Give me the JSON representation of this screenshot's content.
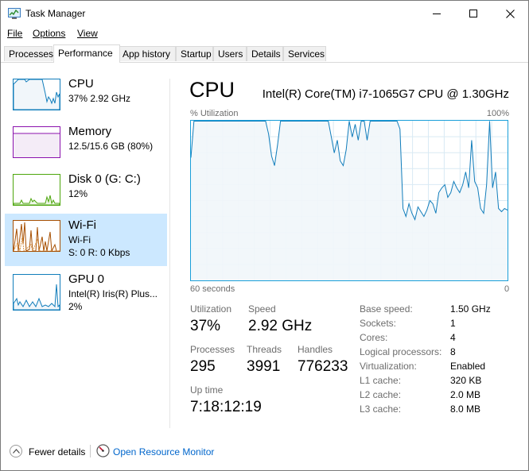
{
  "window": {
    "title": "Task Manager",
    "icons": {
      "app": "task-manager-icon",
      "minimize": "minimize-icon",
      "maximize": "maximize-icon",
      "close": "close-icon"
    }
  },
  "menu": [
    {
      "label": "File"
    },
    {
      "label": "Options"
    },
    {
      "label": "View"
    }
  ],
  "tabs": [
    {
      "label": "Processes"
    },
    {
      "label": "Performance",
      "active": true
    },
    {
      "label": "App history"
    },
    {
      "label": "Startup"
    },
    {
      "label": "Users"
    },
    {
      "label": "Details"
    },
    {
      "label": "Services"
    }
  ],
  "sidebar": {
    "items": [
      {
        "name": "CPU",
        "line1": "37%  2.92 GHz",
        "line2": "",
        "color": "#117dbb"
      },
      {
        "name": "Memory",
        "line1": "12.5/15.6 GB (80%)",
        "line2": "",
        "color": "#8b12ae"
      },
      {
        "name": "Disk 0 (G: C:)",
        "line1": "12%",
        "line2": "",
        "color": "#4da60c"
      },
      {
        "name": "Wi-Fi",
        "line1": "Wi-Fi",
        "line2": "S: 0  R: 0 Kbps",
        "color": "#a74f01",
        "selected": true
      },
      {
        "name": "GPU 0",
        "line1": "Intel(R) Iris(R) Plus...",
        "line2": "2%",
        "color": "#117dbb"
      }
    ]
  },
  "main": {
    "title": "CPU",
    "cpu_name": "Intel(R) Core(TM) i7-1065G7 CPU @ 1.30GHz",
    "graph": {
      "ylabel": "% Utilization",
      "ymax_label": "100%",
      "xlabel_left": "60 seconds",
      "xlabel_right": "0",
      "line_color": "#117dbb",
      "fill_color": "#f1f6fa",
      "grid_color": "#d9eaf4",
      "utilization": [
        77,
        100,
        100,
        100,
        100,
        100,
        100,
        100,
        100,
        100,
        100,
        100,
        100,
        100,
        100,
        100,
        100,
        100,
        100,
        100,
        100,
        100,
        100,
        100,
        100,
        100,
        92,
        78,
        72,
        85,
        100,
        100,
        100,
        100,
        100,
        100,
        100,
        100,
        100,
        100,
        100,
        100,
        100,
        100,
        100,
        100,
        100,
        90,
        80,
        88,
        75,
        72,
        82,
        100,
        90,
        98,
        88,
        100,
        100,
        88,
        100,
        100,
        100,
        100,
        100,
        100,
        100,
        100,
        100,
        100,
        95,
        45,
        40,
        48,
        42,
        38,
        46,
        43,
        40,
        44,
        50,
        48,
        42,
        55,
        58,
        60,
        52,
        55,
        62,
        58,
        55,
        60,
        68,
        58,
        88,
        62,
        58,
        45,
        42,
        60,
        100,
        58,
        68,
        45,
        43,
        45,
        44
      ]
    },
    "stats": {
      "utilization_label": "Utilization",
      "utilization": "37%",
      "speed_label": "Speed",
      "speed": "2.92 GHz",
      "processes_label": "Processes",
      "processes": "295",
      "threads_label": "Threads",
      "threads": "3991",
      "handles_label": "Handles",
      "handles": "776233",
      "uptime_label": "Up time",
      "uptime": "7:18:12:19"
    },
    "specs": [
      {
        "label": "Base speed:",
        "value": "1.50 GHz"
      },
      {
        "label": "Sockets:",
        "value": "1"
      },
      {
        "label": "Cores:",
        "value": "4"
      },
      {
        "label": "Logical processors:",
        "value": "8"
      },
      {
        "label": "Virtualization:",
        "value": "Enabled"
      },
      {
        "label": "L1 cache:",
        "value": "320 KB"
      },
      {
        "label": "L2 cache:",
        "value": "2.0 MB"
      },
      {
        "label": "L3 cache:",
        "value": "8.0 MB"
      }
    ]
  },
  "footer": {
    "fewer_details": "Fewer details",
    "open_resource_monitor": "Open Resource Monitor",
    "icons": {
      "fewer": "chevron-up-icon",
      "resmon": "resource-monitor-icon"
    }
  }
}
